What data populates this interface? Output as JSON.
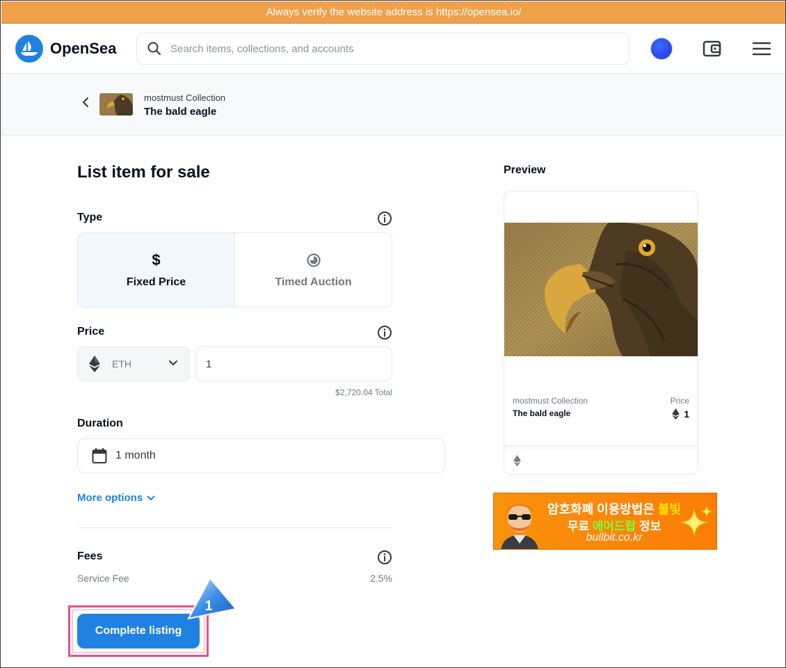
{
  "banner": {
    "text": "Always verify the website address is https://opensea.io/"
  },
  "nav": {
    "logo_text": "OpenSea",
    "search_placeholder": "Search items, collections, and accounts"
  },
  "breadcrumb": {
    "collection": "mostmust Collection",
    "item": "The bald eagle"
  },
  "form": {
    "title": "List item for sale",
    "type_label": "Type",
    "type_options": [
      {
        "icon": "$",
        "label": "Fixed Price",
        "selected": true
      },
      {
        "icon": "clock-icon",
        "label": "Timed Auction",
        "selected": false
      }
    ],
    "price_label": "Price",
    "currency": "ETH",
    "price_value": "1",
    "price_total": "$2,720.04 Total",
    "duration_label": "Duration",
    "duration_value": "1 month",
    "more_options": "More options",
    "fees_label": "Fees",
    "service_fee_label": "Service Fee",
    "service_fee_value": "2.5%",
    "submit_label": "Complete listing"
  },
  "annotation": {
    "step": "1"
  },
  "preview": {
    "title": "Preview",
    "collection": "mostmust Collection",
    "name": "The bald eagle",
    "price_label": "Price",
    "price": "1"
  },
  "ad": {
    "line1_a": "암호화폐 이용방법은 ",
    "line1_b": "불빛",
    "line2_a": "무료 ",
    "line2_b": "에어드랍",
    "line2_c": " 정보",
    "line3": "bullbit.co.kr"
  },
  "colors": {
    "accent": "#2081e2",
    "banner": "#f0a04b",
    "highlight": "#ea4f8c"
  }
}
